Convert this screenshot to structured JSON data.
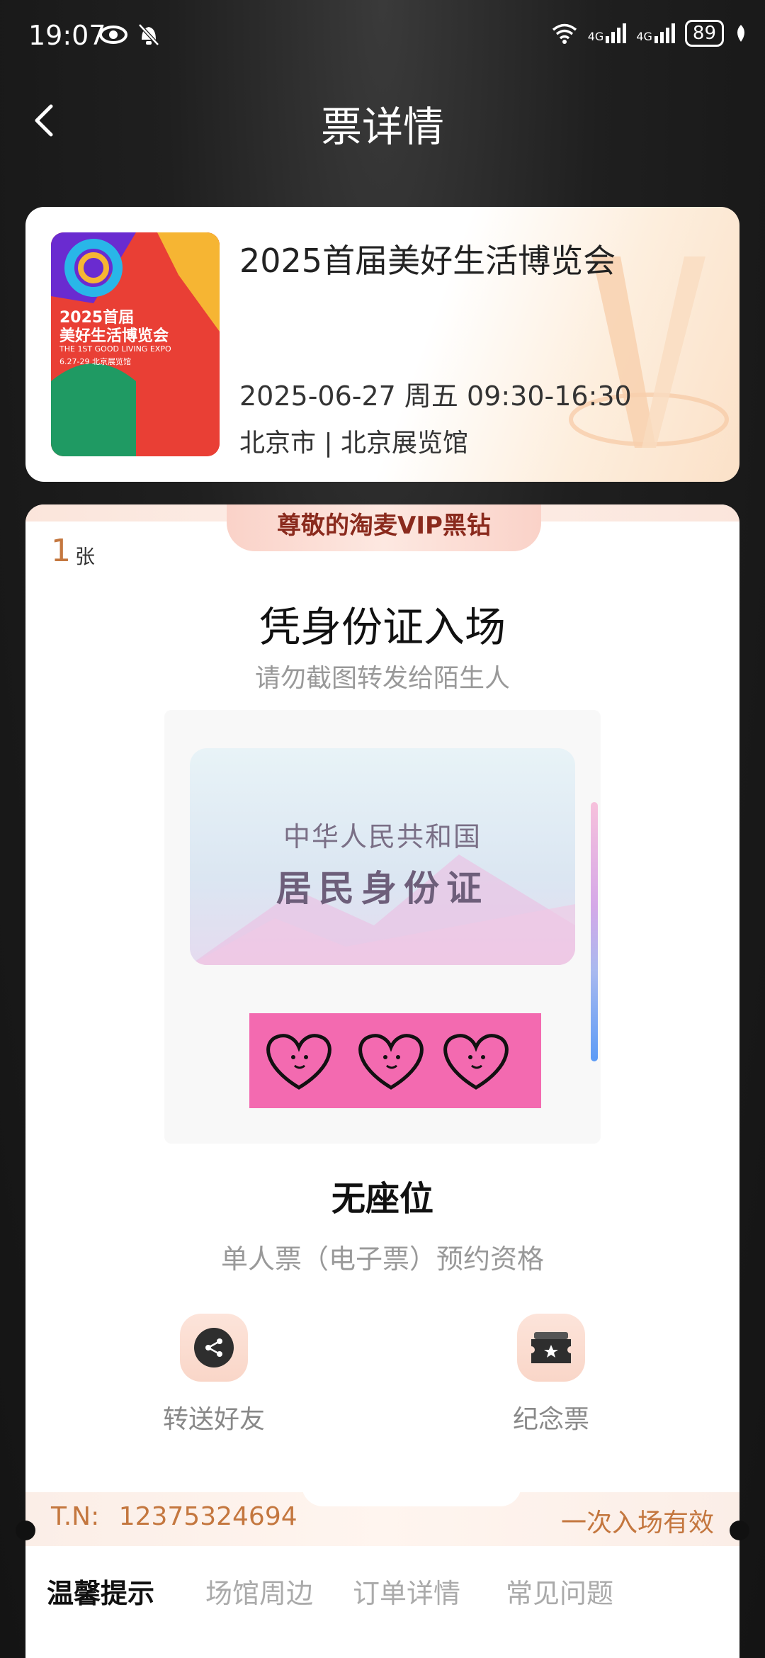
{
  "status_bar": {
    "time": "19:07",
    "battery": "89",
    "network1": "4G",
    "network2": "4G"
  },
  "header": {
    "title": "票详情"
  },
  "event": {
    "title": "2025首届美好生活博览会",
    "date_time": "2025-06-27 周五 09:30-16:30",
    "venue": "北京市 | 北京展览馆",
    "poster": {
      "title_line1": "2025首届",
      "title_line2": "美好生活博览会",
      "subtitle": "THE 1ST GOOD LIVING EXPO",
      "dates": "6.27-29 北京展览馆"
    }
  },
  "ticket": {
    "vip_badge": "尊敬的淘麦VIP黑钻",
    "count": "1",
    "count_unit": "张",
    "entry_title": "凭身份证入场",
    "entry_subtitle": "请勿截图转发给陌生人",
    "id_card": {
      "line1": "中华人民共和国",
      "line2": "居民身份证"
    },
    "seat": "无座位",
    "ticket_type": "单人票（电子票）预约资格",
    "actions": [
      {
        "label": "转送好友",
        "icon": "share-icon"
      },
      {
        "label": "纪念票",
        "icon": "souvenir-ticket-icon"
      }
    ],
    "tn_label": "T.N:",
    "tn_value": "12375324694",
    "validity": "一次入场有效"
  },
  "tabs": [
    {
      "label": "温馨提示",
      "active": true
    },
    {
      "label": "场馆周边",
      "active": false
    },
    {
      "label": "订单详情",
      "active": false
    },
    {
      "label": "常见问题",
      "active": false
    }
  ]
}
